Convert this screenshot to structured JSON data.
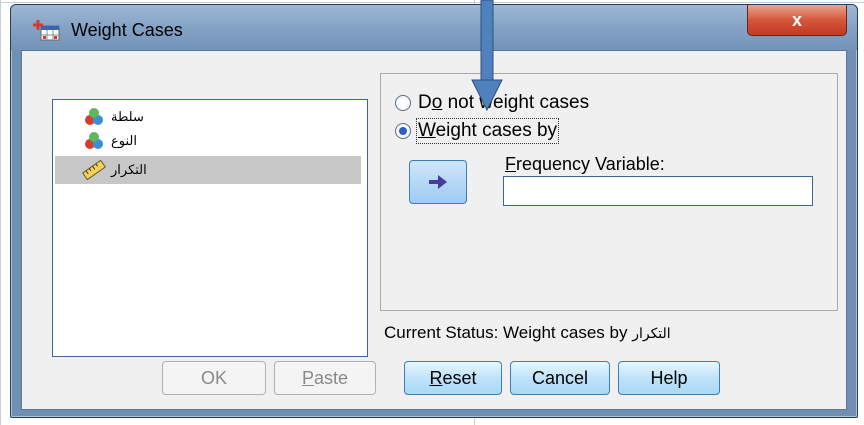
{
  "window": {
    "title": "Weight Cases",
    "close_glyph": "x"
  },
  "variables": [
    {
      "label": "سلطة",
      "icon": "nominal-variable-icon",
      "selected": false
    },
    {
      "label": "النوع",
      "icon": "nominal-variable-icon",
      "selected": false
    },
    {
      "label": "التكرار",
      "icon": "scale-variable-icon",
      "selected": true
    }
  ],
  "options": {
    "do_not_weight": {
      "prefix": "D",
      "accel": "o",
      "rest": " not weight cases",
      "checked": false
    },
    "weight_by": {
      "accel": "W",
      "rest": "eight cases by",
      "checked": true
    }
  },
  "frequency": {
    "accel": "F",
    "rest": "requency Variable:",
    "value": ""
  },
  "status": {
    "prefix": "Current Status: Weight cases by",
    "variable": "التكرار"
  },
  "buttons": {
    "ok": "OK",
    "paste_accel": "P",
    "paste_rest": "aste",
    "reset_accel": "R",
    "reset_rest": "eset",
    "cancel": "Cancel",
    "help": "Help"
  },
  "colors": {
    "accent": "#3c7fb1",
    "annotation_arrow": "#4f81bd"
  }
}
